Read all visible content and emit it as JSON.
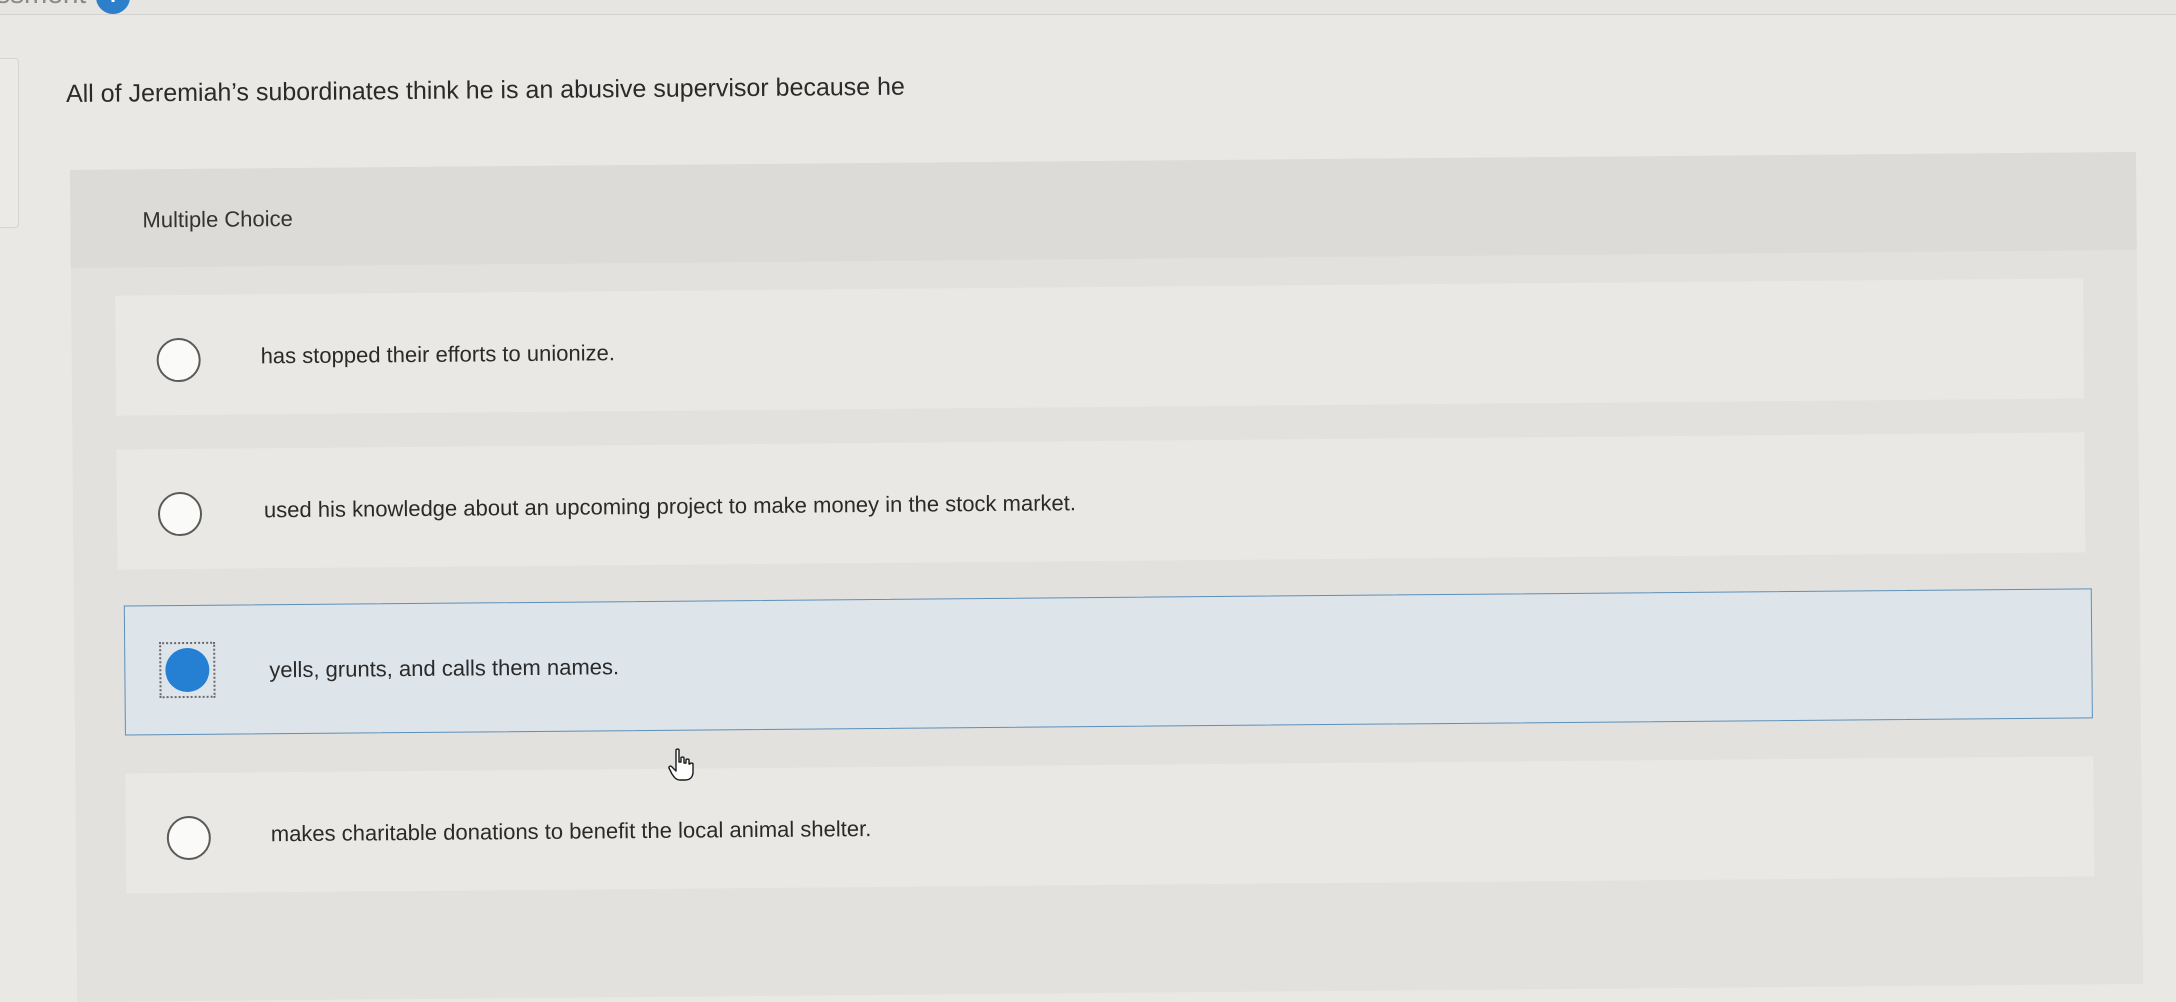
{
  "header": {
    "crumb": "ssment",
    "info_badge": "i"
  },
  "question": {
    "text": "All of Jeremiah’s subordinates think he is an abusive supervisor because he",
    "type_label": "Multiple Choice"
  },
  "options": [
    {
      "text": "has stopped their efforts to unionize.",
      "selected": false
    },
    {
      "text": "used his knowledge about an upcoming project to make money in the stock market.",
      "selected": false
    },
    {
      "text": "yells, grunts, and calls them names.",
      "selected": true
    },
    {
      "text": "makes charitable donations to benefit the local animal shelter.",
      "selected": false
    }
  ],
  "colors": {
    "selected_fill": "#2580d4",
    "selected_row_border": "#5d8fb8",
    "selected_row_background": "#dde5ea"
  },
  "icons": {
    "cursor": "hand-pointer-icon",
    "info": "info-icon"
  }
}
